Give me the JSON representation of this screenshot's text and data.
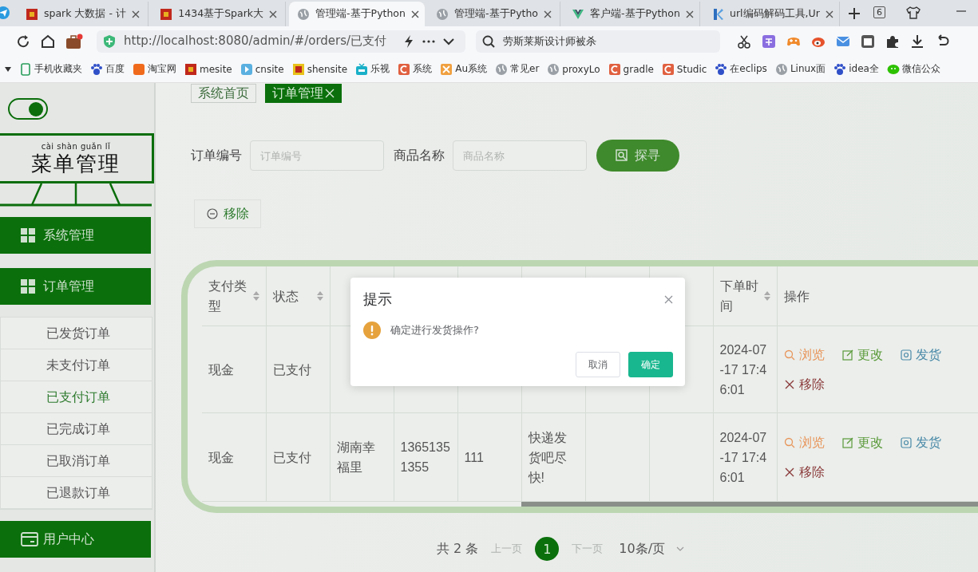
{
  "browser": {
    "tabs": [
      {
        "title": "spark 大数据 - 计",
        "selected": false
      },
      {
        "title": "1434基于Spark大",
        "selected": false
      },
      {
        "title": "管理端-基于Python",
        "selected": true
      },
      {
        "title": "管理端-基于Pytho",
        "selected": false
      },
      {
        "title": "客户端-基于Python",
        "selected": false
      },
      {
        "title": "url编码解码工具,Ur",
        "selected": false
      }
    ],
    "tab_count": "6",
    "url": "http://localhost:8080/admin/#/orders/已支付",
    "search": "劳斯莱斯设计师被杀",
    "bookmarks": [
      "手机收藏夹",
      "百度",
      "淘宝网",
      "mesite",
      "cnsite",
      "shensite",
      "乐视",
      "系统",
      "Au系统",
      "常见er",
      "proxyLo",
      "gradle",
      "Studic",
      "在eclips",
      "Linux面",
      "idea全",
      "微信公众"
    ]
  },
  "sidebar": {
    "toggle": {
      "on": true
    },
    "logo": {
      "pinyin": "cài shàn guǎn lǐ",
      "title": "菜单管理"
    },
    "menu": [
      {
        "label": "系统管理",
        "expanded": false
      },
      {
        "label": "订单管理",
        "expanded": true,
        "children": [
          {
            "label": "已发货订单",
            "selected": false
          },
          {
            "label": "未支付订单",
            "selected": false
          },
          {
            "label": "已支付订单",
            "selected": true
          },
          {
            "label": "已完成订单",
            "selected": false
          },
          {
            "label": "已取消订单",
            "selected": false
          },
          {
            "label": "已退款订单",
            "selected": false
          }
        ]
      },
      {
        "label": "用户中心",
        "expanded": false
      }
    ]
  },
  "breadcrumb": [
    {
      "label": "系统首页",
      "selected": false
    },
    {
      "label": "订单管理",
      "selected": true
    }
  ],
  "search_form": {
    "fields": [
      {
        "label": "订单编号",
        "placeholder": "订单编号"
      },
      {
        "label": "商品名称",
        "placeholder": "商品名称"
      }
    ],
    "button": "探寻"
  },
  "remove_button": "移除",
  "table": {
    "columns": [
      {
        "kind": "label",
        "label": "支付类型",
        "sortable": true
      },
      {
        "kind": "label",
        "label": "状态",
        "sortable": true
      },
      {
        "kind": "hidden"
      },
      {
        "kind": "hidden"
      },
      {
        "kind": "hidden"
      },
      {
        "kind": "hidden"
      },
      {
        "kind": "hidden"
      },
      {
        "kind": "hidden"
      },
      {
        "kind": "label",
        "label": "下单时间",
        "sortable": true
      },
      {
        "kind": "label",
        "label": "操作",
        "sortable": false
      }
    ],
    "rows": [
      {
        "pay_type": "现金",
        "status": "已支付",
        "time": "2024-07-17 17:46:01",
        "actions": [
          {
            "kind": "view",
            "label": "浏览"
          },
          {
            "kind": "edit",
            "label": "更改"
          },
          {
            "kind": "ship",
            "label": "发货"
          },
          {
            "kind": "remove",
            "label": "移除"
          }
        ]
      },
      {
        "pay_type": "现金",
        "status": "已支付",
        "address": "湖南幸福里",
        "phone": "13651351355",
        "receiver": "111",
        "remark": "快递发货吧尽快!",
        "time": "2024-07-17 17:46:01",
        "actions": [
          {
            "kind": "view",
            "label": "浏览"
          },
          {
            "kind": "edit",
            "label": "更改"
          },
          {
            "kind": "ship",
            "label": "发货"
          },
          {
            "kind": "remove",
            "label": "移除"
          }
        ]
      }
    ]
  },
  "pagination": {
    "total": "共 2 条",
    "prev": {
      "label": "上一页",
      "disabled": true
    },
    "pages": [
      {
        "label": "1",
        "selected": true
      }
    ],
    "next": {
      "label": "下一页",
      "disabled": true
    },
    "page_size": "10条/页"
  },
  "dialog": {
    "title": "提示",
    "message": "确定进行发货操作?",
    "buttons": [
      {
        "kind": "cancel",
        "label": "取消"
      },
      {
        "kind": "confirm",
        "label": "确定"
      }
    ]
  }
}
